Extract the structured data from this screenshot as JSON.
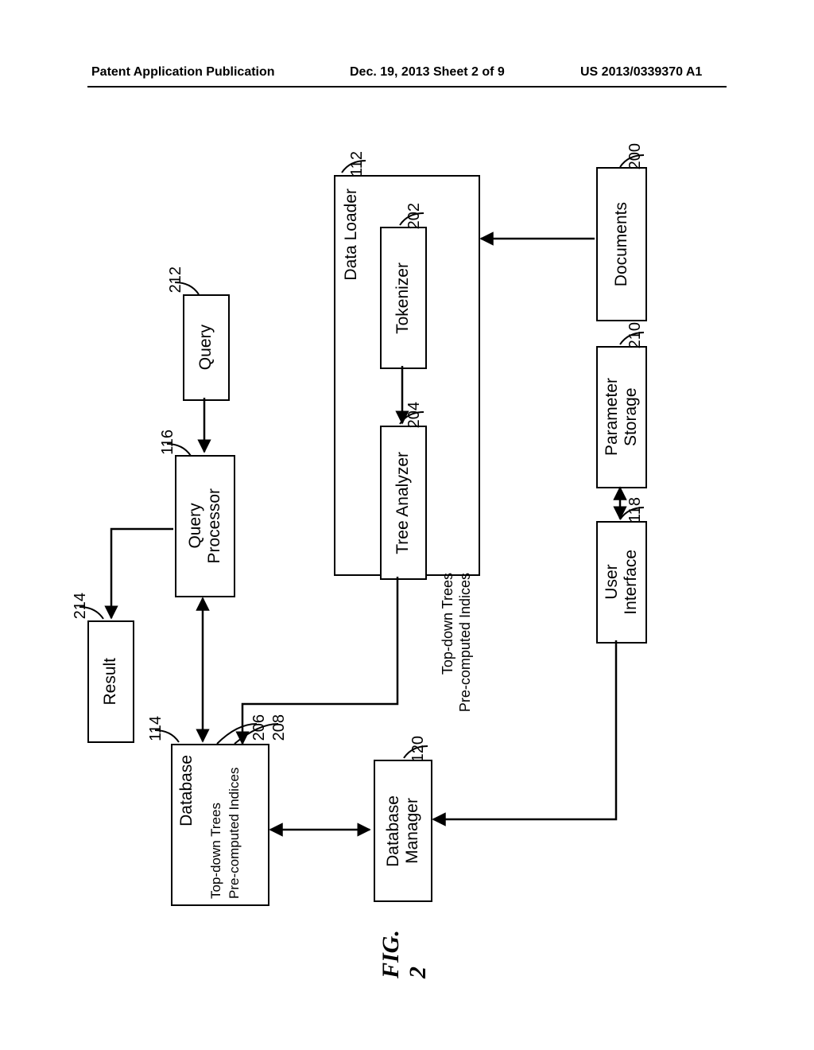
{
  "header": {
    "left": "Patent Application Publication",
    "center": "Dec. 19, 2013  Sheet 2 of 9",
    "right": "US 2013/0339370 A1"
  },
  "figure_label": "FIG. 2",
  "boxes": {
    "documents": "Documents",
    "parameter_storage": "Parameter\nStorage",
    "user_interface": "User\nInterface",
    "data_loader": "Data Loader",
    "tokenizer": "Tokenizer",
    "tree_analyzer": "Tree Analyzer",
    "database_manager": "Database\nManager",
    "query": "Query",
    "query_processor": "Query\nProcessor",
    "result": "Result",
    "database": "Database",
    "db_trees": "Top-down Trees",
    "db_indices": "Pre-computed Indices"
  },
  "edge_label": {
    "trees": "Top-down Trees",
    "indices": "Pre-computed Indices"
  },
  "refs": {
    "r112": "112",
    "r200": "200",
    "r210": "210",
    "r118": "118",
    "r202": "202",
    "r204": "204",
    "r120": "120",
    "r212": "212",
    "r116": "116",
    "r214": "214",
    "r114": "114",
    "r206": "206",
    "r208": "208"
  }
}
